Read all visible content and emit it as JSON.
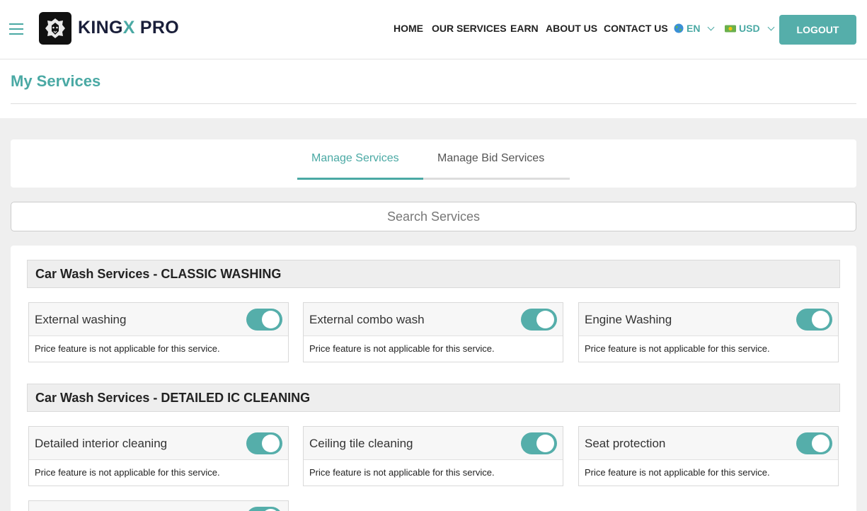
{
  "header": {
    "logo_text_a": "KING",
    "logo_text_b": "X",
    "logo_text_c": " PRO",
    "nav": [
      "HOME",
      "OUR SERVICES",
      "EARN",
      "ABOUT US",
      "CONTACT US"
    ],
    "language": "EN",
    "currency": "USD",
    "logout": "LOGOUT"
  },
  "page": {
    "title": "My Services"
  },
  "tabs": [
    "Manage Services",
    "Manage Bid Services"
  ],
  "search": {
    "placeholder": "Search Services"
  },
  "categories": [
    {
      "title": "Car Wash Services - CLASSIC WASHING",
      "services": [
        {
          "name": "External washing",
          "enabled": true,
          "note": "Price feature is not applicable for this service."
        },
        {
          "name": "External combo wash",
          "enabled": true,
          "note": "Price feature is not applicable for this service."
        },
        {
          "name": "Engine Washing",
          "enabled": true,
          "note": "Price feature is not applicable for this service."
        }
      ]
    },
    {
      "title": "Car Wash Services - DETAILED IC CLEANING",
      "services": [
        {
          "name": "Detailed interior cleaning",
          "enabled": true,
          "note": "Price feature is not applicable for this service."
        },
        {
          "name": "Ceiling tile cleaning",
          "enabled": true,
          "note": "Price feature is not applicable for this service."
        },
        {
          "name": "Seat protection",
          "enabled": true,
          "note": "Price feature is not applicable for this service."
        }
      ]
    }
  ],
  "colors": {
    "accent": "#4aa9a4",
    "button": "#55aeaa",
    "navy": "#1a1f3a"
  }
}
